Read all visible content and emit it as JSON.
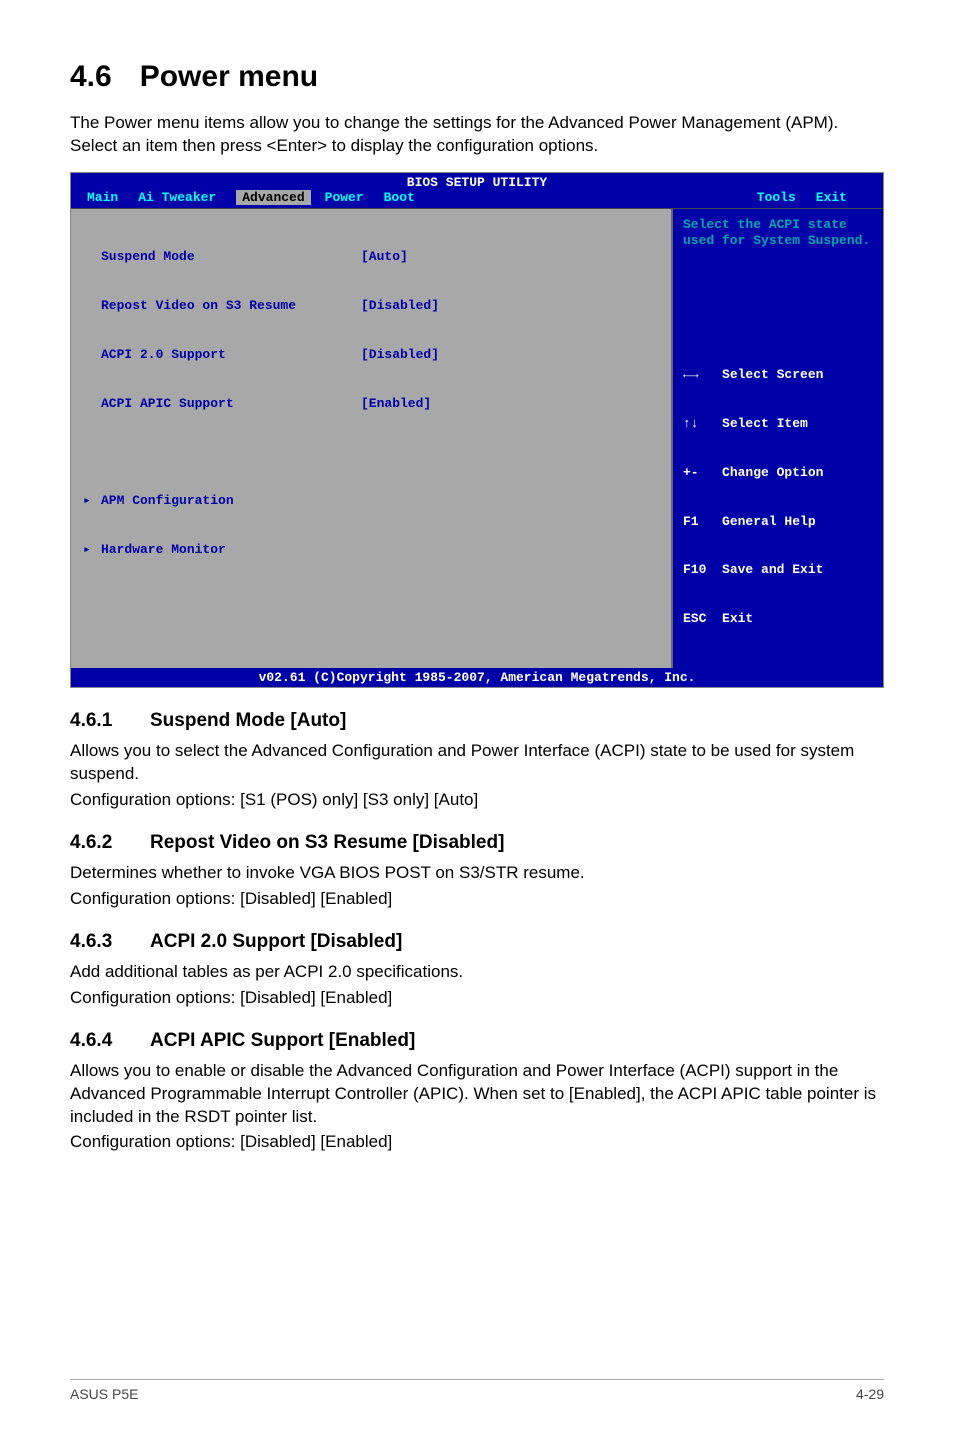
{
  "heading": {
    "number": "4.6",
    "title": "Power menu"
  },
  "intro": "The Power menu items allow you to change the settings for the Advanced Power Management (APM). Select an item then press <Enter> to display the configuration options.",
  "bios": {
    "title": "BIOS SETUP UTILITY",
    "menu": {
      "main": "Main",
      "ai_tweaker": "Ai Tweaker",
      "advanced": "Advanced",
      "power": "Power",
      "boot": "Boot",
      "tools": "Tools",
      "exit": "Exit"
    },
    "rows": [
      {
        "label": "Suspend Mode",
        "value": "[Auto]"
      },
      {
        "label": "Repost Video on S3 Resume",
        "value": "[Disabled]"
      },
      {
        "label": "ACPI 2.0 Support",
        "value": "[Disabled]"
      },
      {
        "label": "ACPI APIC Support",
        "value": "[Enabled]"
      }
    ],
    "submenus": [
      "APM Configuration",
      "Hardware Monitor"
    ],
    "help": "Select the ACPI state used for System Suspend.",
    "keys": {
      "k1": {
        "icon": "←→",
        "label": "Select Screen"
      },
      "k2": {
        "icon": "↑↓",
        "label": "Select Item"
      },
      "k3": {
        "icon": "+-",
        "label": "Change Option"
      },
      "k4": {
        "icon": "F1",
        "label": "General Help"
      },
      "k5": {
        "icon": "F10",
        "label": "Save and Exit"
      },
      "k6": {
        "icon": "ESC",
        "label": "Exit"
      }
    },
    "footer": "v02.61 (C)Copyright 1985-2007, American Megatrends, Inc."
  },
  "sections": {
    "s1": {
      "num": "4.6.1",
      "title": "Suspend Mode [Auto]",
      "body": "Allows you to select the Advanced Configuration and Power Interface (ACPI) state to be used for system suspend.",
      "cfg": "Configuration options: [S1 (POS) only] [S3 only] [Auto]"
    },
    "s2": {
      "num": "4.6.2",
      "title": "Repost Video on S3 Resume [Disabled]",
      "body": "Determines whether to invoke VGA BIOS POST on S3/STR resume.",
      "cfg": "Configuration options: [Disabled] [Enabled]"
    },
    "s3": {
      "num": "4.6.3",
      "title": "ACPI 2.0 Support [Disabled]",
      "body": "Add additional tables as per ACPI 2.0 specifications.",
      "cfg": "Configuration options: [Disabled] [Enabled]"
    },
    "s4": {
      "num": "4.6.4",
      "title": "ACPI APIC Support [Enabled]",
      "body": "Allows you to enable or disable the Advanced Configuration and Power Interface (ACPI) support in the Advanced Programmable Interrupt Controller (APIC). When set to [Enabled], the ACPI APIC table pointer is included in the RSDT pointer list.",
      "cfg": "Configuration options: [Disabled] [Enabled]"
    }
  },
  "page_footer": {
    "left": "ASUS P5E",
    "right": "4-29"
  }
}
